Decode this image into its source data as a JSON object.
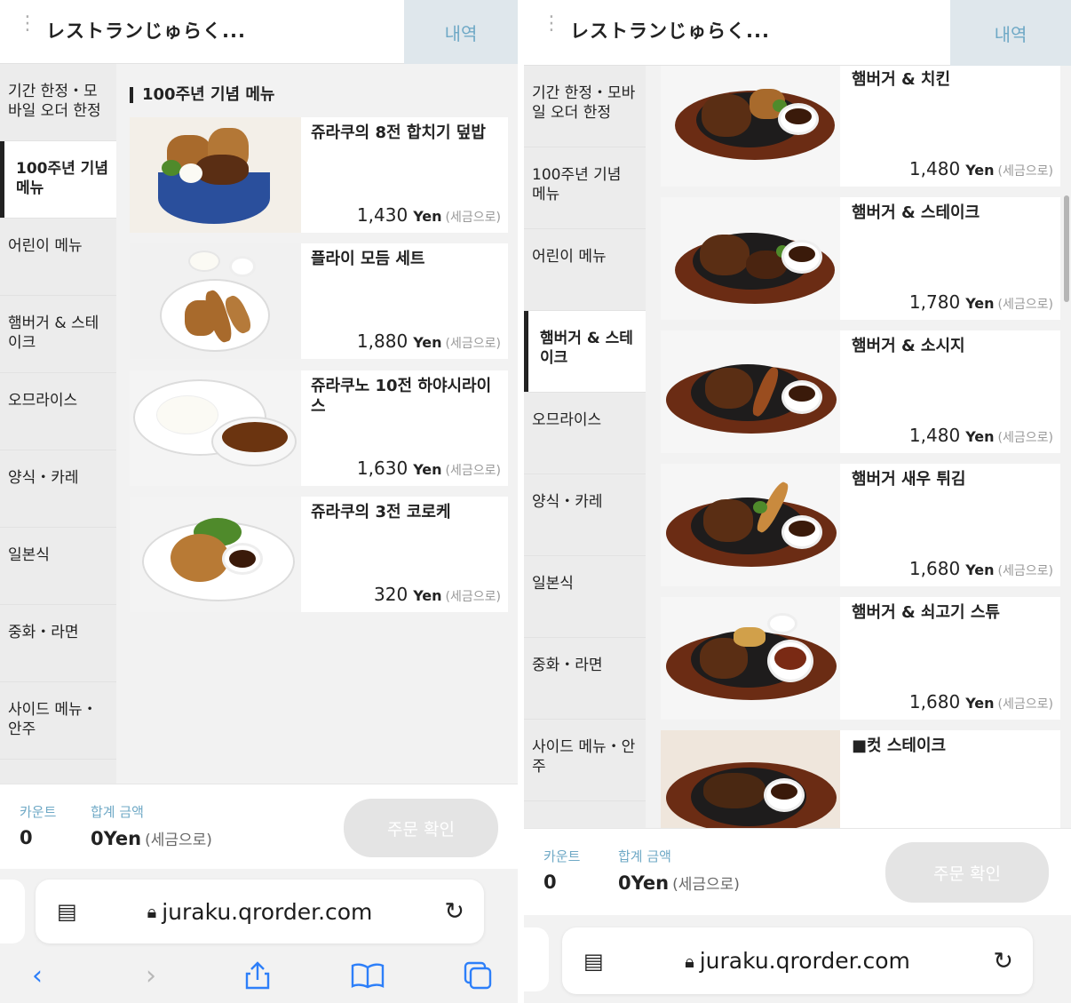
{
  "header": {
    "title": "レストランじゅらく...",
    "history_label": "내역"
  },
  "sidebar": {
    "items": [
      {
        "label": "기간 한정・모바일 오더 한정"
      },
      {
        "label": "100주년 기념 메뉴"
      },
      {
        "label": "어린이 메뉴"
      },
      {
        "label": "햄버거 & 스테이크"
      },
      {
        "label": "오므라이스"
      },
      {
        "label": "양식・카레"
      },
      {
        "label": "일본식"
      },
      {
        "label": "중화・라면"
      },
      {
        "label": "사이드 메뉴・안주"
      }
    ]
  },
  "left_screen": {
    "active_category": "100주년 기념 메뉴",
    "section_title": "100주년 기념 메뉴",
    "items": [
      {
        "name": "쥬라쿠의 8전 합치기 덮밥",
        "price": "1,430",
        "currency": "Yen",
        "tax_note": "(세금으로)"
      },
      {
        "name": "플라이 모듬 세트",
        "price": "1,880",
        "currency": "Yen",
        "tax_note": "(세금으로)"
      },
      {
        "name": "쥬라쿠노 10전 하야시라이스",
        "price": "1,630",
        "currency": "Yen",
        "tax_note": "(세금으로)"
      },
      {
        "name": "쥬라쿠의 3전 코로케",
        "price": "320",
        "currency": "Yen",
        "tax_note": "(세금으로)"
      }
    ]
  },
  "right_screen": {
    "active_category": "햄버거 & 스테이크",
    "items": [
      {
        "name": "햄버거 & 치킨",
        "price": "1,480",
        "currency": "Yen",
        "tax_note": "(세금으로)"
      },
      {
        "name": "햄버거 & 스테이크",
        "price": "1,780",
        "currency": "Yen",
        "tax_note": "(세금으로)"
      },
      {
        "name": "햄버거 & 소시지",
        "price": "1,480",
        "currency": "Yen",
        "tax_note": "(세금으로)"
      },
      {
        "name": "햄버거 새우 튀김",
        "price": "1,680",
        "currency": "Yen",
        "tax_note": "(세금으로)"
      },
      {
        "name": "햄버거 & 쇠고기 스튜",
        "price": "1,680",
        "currency": "Yen",
        "tax_note": "(세금으로)"
      },
      {
        "name": "■컷 스테이크"
      }
    ]
  },
  "bottom_bar": {
    "count_label": "카운트",
    "count_value": "0",
    "total_label": "합계 금액",
    "total_value": "0Yen",
    "total_tax_note": "(세금으로)",
    "order_button_label": "주문 확인"
  },
  "browser": {
    "url": "juraku.qrorder.com",
    "reader_icon": "reader-mode-icon",
    "lock_icon": "lock-icon",
    "reload_icon": "reload-icon",
    "nav": [
      "back-icon",
      "forward-icon",
      "share-icon",
      "bookmarks-icon",
      "tabs-icon"
    ]
  },
  "colors": {
    "accent_blue": "#6fa9c6",
    "ios_blue": "#2d7ff9",
    "active_marker": "#222222",
    "disabled_button": "#e4e4e4"
  }
}
